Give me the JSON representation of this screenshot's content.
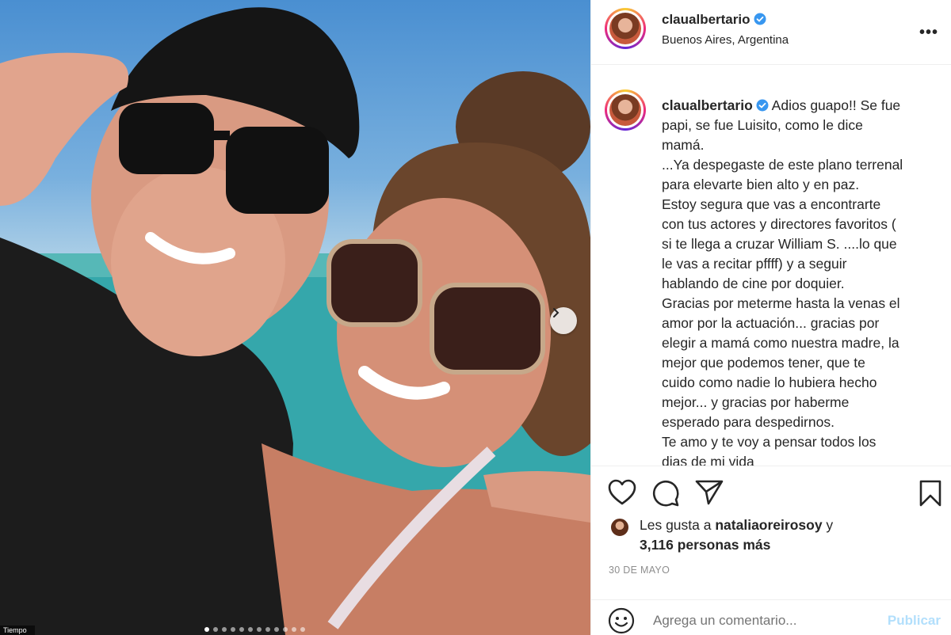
{
  "post": {
    "username": "claualbertario",
    "verified": true,
    "location": "Buenos Aires, Argentina",
    "more_icon": "more-options-icon",
    "caption_lines": [
      " Adios guapo!! Se fue",
      "papi, se fue Luisito, como le dice",
      "mamá.",
      "...Ya despegaste de este plano terrenal",
      "para elevarte bien alto y en paz.",
      "Estoy segura que vas a encontrarte",
      "con tus actores y directores favoritos (",
      "si te llega a cruzar William S. ....lo que",
      "le vas a recitar pffff) y a seguir",
      "hablando de cine por doquier.",
      "Gracias por meterme hasta la venas el",
      "amor por la actuación... gracias por",
      "elegir a mamá como nuestra madre, la",
      "mejor que podemos tener, que te",
      "cuido como nadie lo hubiera hecho",
      "mejor... y gracias por haberme",
      "esperado para despedirnos.",
      "Te amo y te voy a pensar todos los",
      "dias de mi vida"
    ],
    "likes": {
      "prefix": "Les gusta a ",
      "liker": "nataliaoreirosoy",
      "middle": " y",
      "others": "3,116 personas más"
    },
    "date": "30 DE MAYO",
    "comment": {
      "placeholder": "Agrega un comentario...",
      "post_label": "Publicar"
    },
    "carousel": {
      "total_dots": 12,
      "active_index": 0
    },
    "watermark": "Tiempo"
  },
  "icons": [
    "heart-icon",
    "comment-icon",
    "share-icon",
    "bookmark-icon",
    "emoji-icon",
    "verified-icon",
    "chevron-right-icon"
  ],
  "colors": {
    "verified": "#3897f0",
    "post_button": "#b2dffc",
    "muted": "#8e8e8e"
  }
}
